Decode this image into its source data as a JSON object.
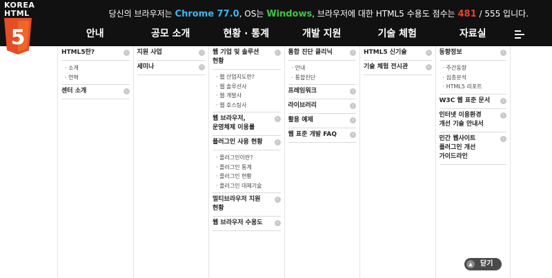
{
  "logo": {
    "line1": "KOREA",
    "line2": "HTML",
    "digit": "5"
  },
  "score": {
    "prefix": "당신의 브라우저는",
    "browser": "Chrome 77.0",
    "os_prefix": ", OS는",
    "os": "Windows",
    "middle": ", 브라우저에 대한 HTML5 수용도 점수는",
    "points": "481",
    "total": "/ 555 입니다."
  },
  "nav": [
    "안내",
    "공모 소개",
    "현황 · 통계",
    "개발 지원",
    "기술 체험",
    "자료실"
  ],
  "menu_icon": "hamburger-icon",
  "columns": [
    {
      "groups": [
        {
          "label": "HTML5란?",
          "subs": [
            "소개",
            "연혁"
          ]
        },
        {
          "label": "센터 소개",
          "subs": []
        }
      ]
    },
    {
      "groups": [
        {
          "label": "지원 사업",
          "subs": []
        },
        {
          "label": "세미나",
          "subs": []
        }
      ]
    },
    {
      "groups": [
        {
          "label": "웹 기업 및 솔루션\n현황",
          "subs": [
            "웹 산업지도란?",
            "웹 솔루션사",
            "웹 개발사",
            "웹 호스팅사"
          ]
        },
        {
          "label": "웹 브라우저,\n운영체제 이용률",
          "subs": []
        },
        {
          "label": "플러그인 사용 현황",
          "subs": [
            "플러그인이란?",
            "플러그인 통계",
            "플러그인 현황",
            "플러그인 대체기술"
          ]
        },
        {
          "label": "멀티브라우저 지원\n현황",
          "subs": []
        },
        {
          "label": "웹 브라우저 수용도",
          "subs": []
        }
      ]
    },
    {
      "groups": [
        {
          "label": "통합 진단 클리닉",
          "subs": [
            "안내",
            "통합진단"
          ]
        },
        {
          "label": "프레임워크",
          "subs": []
        },
        {
          "label": "라이브러리",
          "subs": []
        },
        {
          "label": "활용 예제",
          "subs": []
        },
        {
          "label": "웹 표준 개발 FAQ",
          "subs": []
        }
      ]
    },
    {
      "groups": [
        {
          "label": "HTML5 신기술",
          "subs": []
        },
        {
          "label": "기술 체험 전시관",
          "subs": []
        }
      ]
    },
    {
      "groups": [
        {
          "label": "동향정보",
          "subs": [
            "주간동향",
            "심층분석",
            "HTML5 리포트"
          ]
        },
        {
          "label": "W3C 웹 표준 문서",
          "subs": []
        },
        {
          "label": "인터넷 이용환경\n개선 기술 안내서",
          "subs": []
        },
        {
          "label": "민간 웹사이트\n플러그인 개선\n가이드라인",
          "subs": []
        }
      ]
    }
  ],
  "close": {
    "label": "닫기",
    "icon": "chevron-up-icon"
  },
  "colors": {
    "topbar": "#111111",
    "logo": "#e44d26",
    "browser": "#3fb6ea",
    "os": "#3fc545",
    "points": "#e8432b"
  }
}
